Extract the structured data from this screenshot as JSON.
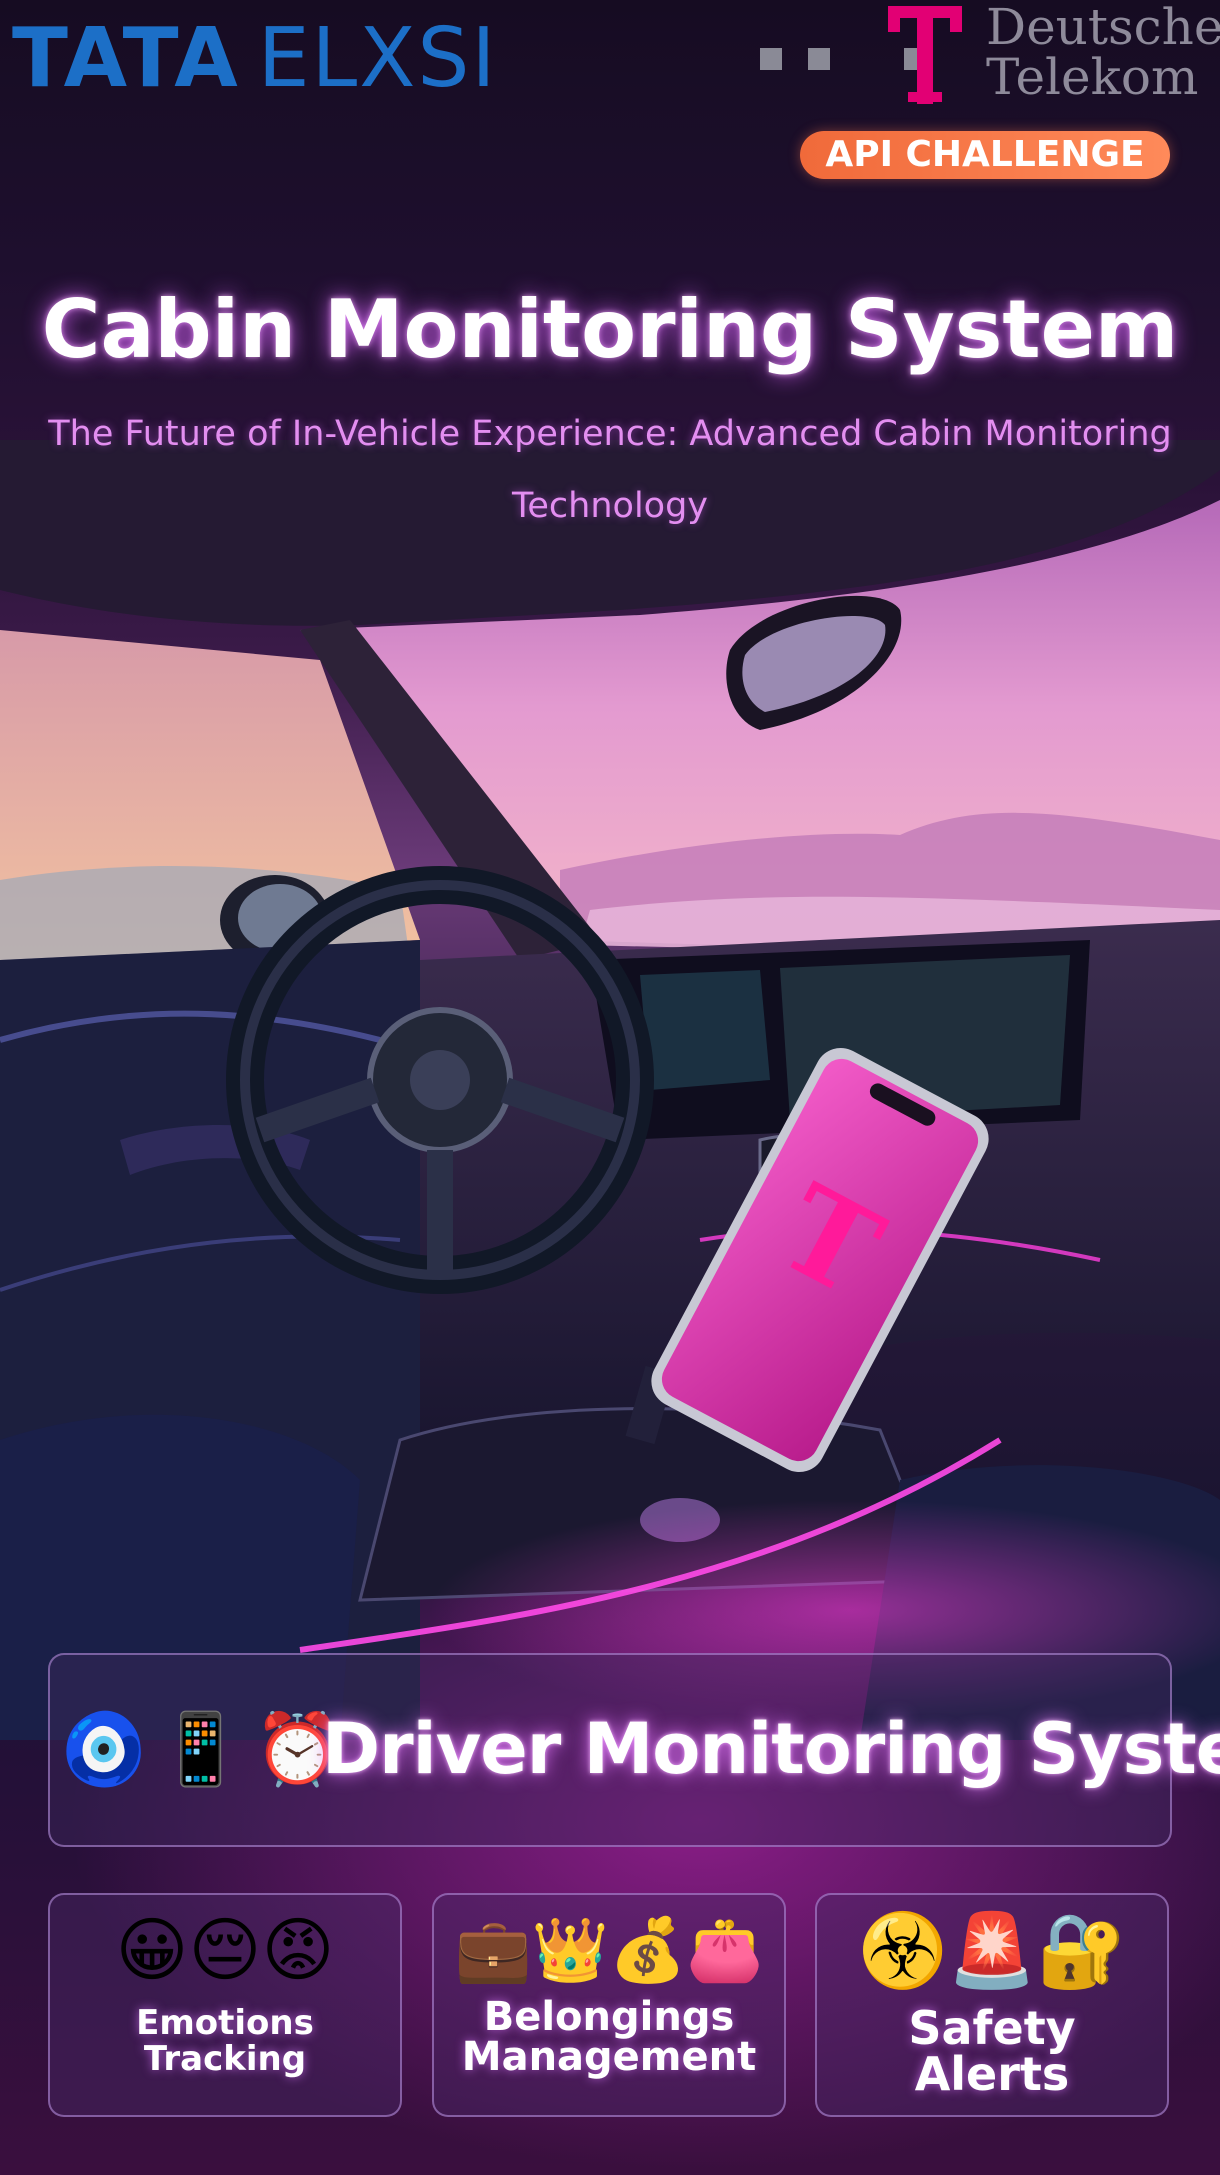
{
  "header": {
    "tata_logo": {
      "word_a": "TATA",
      "word_b": "ELXSI",
      "color": "#1c6fc7"
    },
    "dt_logo": {
      "name": "Deutsche\nTelekom",
      "icon": "telekom-t-logo",
      "brand_color": "#e20074"
    },
    "badge": "API CHALLENGE"
  },
  "hero": {
    "title": "Cabin Monitoring System",
    "subtitle": "The Future of In-Vehicle Experience: Advanced Cabin Monitoring Technology"
  },
  "dms": {
    "icons": [
      "🧿",
      "📱",
      "⏰"
    ],
    "title": "Driver Monitoring System"
  },
  "features": [
    {
      "emoji": "😀😔😡",
      "label": "Emotions\nTracking"
    },
    {
      "emoji": "💼👑💰👛",
      "label": "Belongings\nManagement"
    },
    {
      "emoji": "☣️🚨🔐",
      "label": "Safety\nAlerts"
    }
  ],
  "colors": {
    "accent_magenta": "#e20074",
    "glow_purple": "#d66cff",
    "badge_orange": "#f06a3a"
  }
}
